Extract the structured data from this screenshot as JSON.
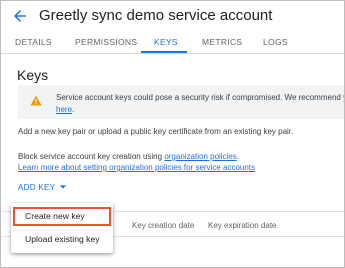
{
  "header": {
    "title": "Greetly sync demo service account",
    "back_icon": "arrow-back-icon"
  },
  "tabs": [
    {
      "label": "DETAILS"
    },
    {
      "label": "PERMISSIONS"
    },
    {
      "label": "KEYS",
      "active": true
    },
    {
      "label": "METRICS"
    },
    {
      "label": "LOGS"
    }
  ],
  "keys": {
    "heading": "Keys",
    "warning": {
      "icon": "warning-icon",
      "text": "Service account keys could pose a security risk if compromised. We recommend yo",
      "link": "here",
      "link_suffix": "."
    },
    "add_key_note": "Add a new key pair or upload a public key certificate from an existing key pair.",
    "block_text": "Block service account key creation using",
    "block_link": "organization policies",
    "learn_more": "Learn more about setting organization policies for service accounts",
    "add_key_button": "ADD KEY",
    "table_headers": [
      "Key creation date",
      "Key expiration date"
    ]
  },
  "menu": {
    "items": [
      {
        "label": "Create new key"
      },
      {
        "label": "Upload existing key"
      }
    ]
  },
  "colors": {
    "accent": "#1a73e8",
    "warning": "#f29900",
    "highlight": "#e8542b"
  }
}
